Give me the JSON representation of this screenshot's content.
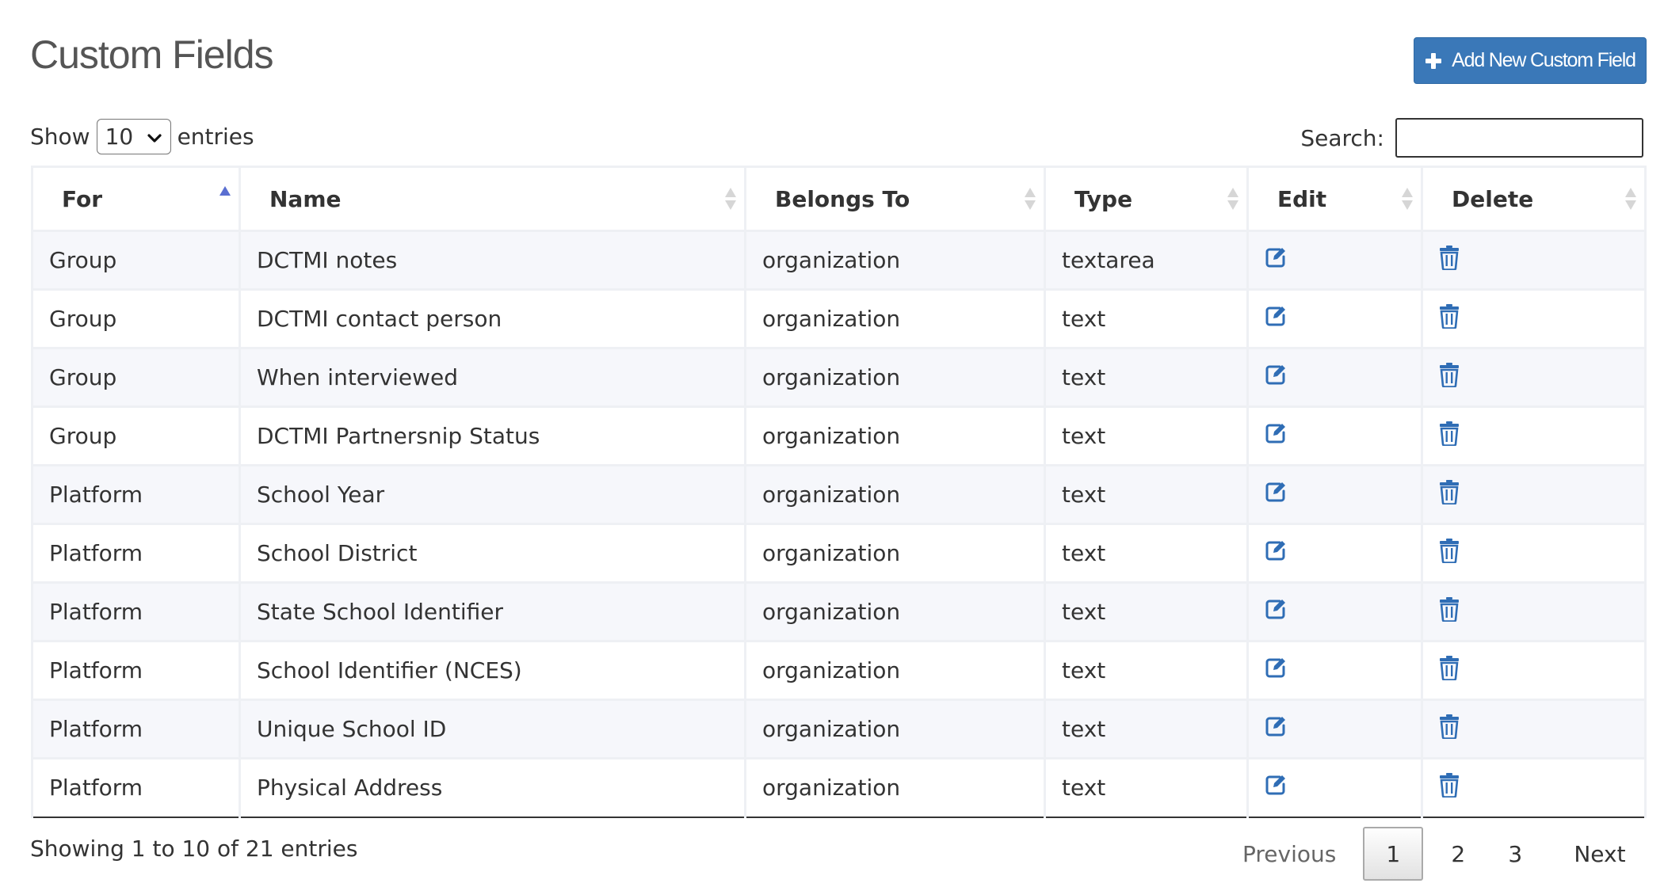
{
  "page": {
    "title": "Custom Fields",
    "add_button_label": "Add New Custom Field",
    "accent_color": "#3a78b8",
    "icon_color": "#2f6db5"
  },
  "length": {
    "show_label": "Show",
    "selected": "10",
    "entries_label": "entries"
  },
  "search": {
    "label": "Search:",
    "value": ""
  },
  "table": {
    "columns": [
      "For",
      "Name",
      "Belongs To",
      "Type",
      "Edit",
      "Delete"
    ],
    "sorted_column": "For",
    "sort_direction": "ascending",
    "rows": [
      {
        "for": "Group",
        "name": "DCTMI notes",
        "belongs_to": "organization",
        "type": "textarea",
        "edit_icon": "edit-icon",
        "delete_icon": "trash-icon"
      },
      {
        "for": "Group",
        "name": "DCTMI contact person",
        "belongs_to": "organization",
        "type": "text",
        "edit_icon": "edit-icon",
        "delete_icon": "trash-icon"
      },
      {
        "for": "Group",
        "name": "When interviewed",
        "belongs_to": "organization",
        "type": "text",
        "edit_icon": "edit-icon",
        "delete_icon": "trash-icon"
      },
      {
        "for": "Group",
        "name": "DCTMI Partnersnip Status",
        "belongs_to": "organization",
        "type": "text",
        "edit_icon": "edit-icon",
        "delete_icon": "trash-icon"
      },
      {
        "for": "Platform",
        "name": "School Year",
        "belongs_to": "organization",
        "type": "text",
        "edit_icon": "edit-icon",
        "delete_icon": "trash-icon"
      },
      {
        "for": "Platform",
        "name": "School District",
        "belongs_to": "organization",
        "type": "text",
        "edit_icon": "edit-icon",
        "delete_icon": "trash-icon"
      },
      {
        "for": "Platform",
        "name": "State School Identifier",
        "belongs_to": "organization",
        "type": "text",
        "edit_icon": "edit-icon",
        "delete_icon": "trash-icon"
      },
      {
        "for": "Platform",
        "name": "School Identifier (NCES)",
        "belongs_to": "organization",
        "type": "text",
        "edit_icon": "edit-icon",
        "delete_icon": "trash-icon"
      },
      {
        "for": "Platform",
        "name": "Unique School ID",
        "belongs_to": "organization",
        "type": "text",
        "edit_icon": "edit-icon",
        "delete_icon": "trash-icon"
      },
      {
        "for": "Platform",
        "name": "Physical Address",
        "belongs_to": "organization",
        "type": "text",
        "edit_icon": "edit-icon",
        "delete_icon": "trash-icon"
      }
    ]
  },
  "footer": {
    "info": "Showing 1 to 10 of 21 entries",
    "previous": "Previous",
    "pages": [
      "1",
      "2",
      "3"
    ],
    "current_page": "1",
    "next": "Next"
  }
}
